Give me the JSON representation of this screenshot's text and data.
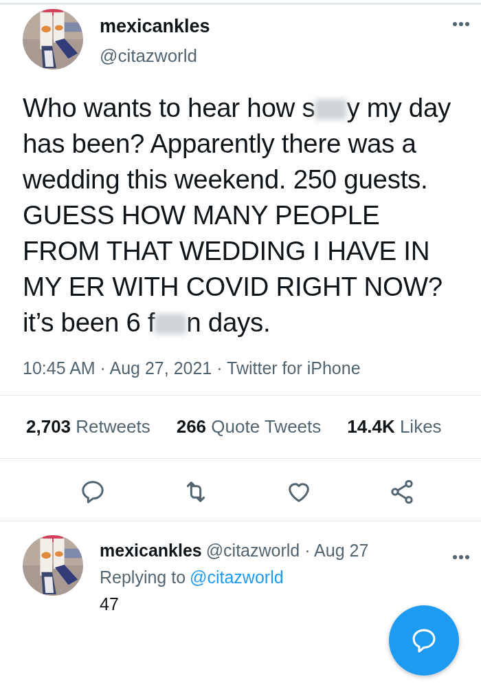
{
  "tweet": {
    "name": "mexicankles",
    "handle": "@citazworld",
    "body": [
      {
        "kind": "text",
        "text": "Who wants to hear how s"
      },
      {
        "kind": "blur"
      },
      {
        "kind": "text",
        "text": "y my day has been? Apparently there was a wedding this weekend. 250 guests. GUESS HOW MANY PEOPLE FROM THAT WEDDING I HAVE IN MY ER WITH COVID RIGHT NOW? it’s been 6 f"
      },
      {
        "kind": "blur"
      },
      {
        "kind": "text",
        "text": "n days."
      }
    ],
    "separator": "·",
    "time": "10:45 AM",
    "date": "Aug 27, 2021",
    "source": "Twitter for iPhone",
    "stats": [
      {
        "count": "2,703",
        "label": "Retweets"
      },
      {
        "count": "266",
        "label": "Quote Tweets"
      },
      {
        "count": "14.4K",
        "label": "Likes"
      }
    ],
    "actions": [
      {
        "kind": "reply"
      },
      {
        "kind": "retweet"
      },
      {
        "kind": "like"
      },
      {
        "kind": "share"
      }
    ]
  },
  "reply": {
    "name": "mexicankles",
    "handle": "@citazworld",
    "separator": "·",
    "date": "Aug 27",
    "replying_label": "Replying to",
    "replying_to": "@citazworld",
    "text": "47"
  }
}
